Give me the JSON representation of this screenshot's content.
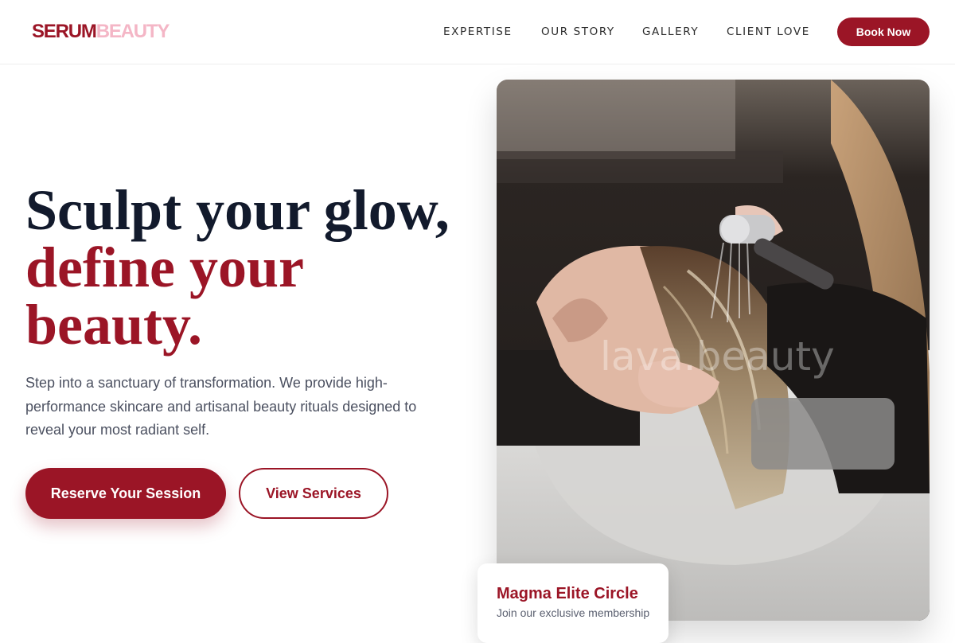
{
  "brand": {
    "part1": "SERUM",
    "part2": "BEAUTY"
  },
  "nav": {
    "items": [
      "EXPERTISE",
      "OUR STORY",
      "GALLERY",
      "CLIENT LOVE"
    ],
    "cta_label": "Book Now"
  },
  "hero": {
    "headline_line1": "Sculpt your glow,",
    "headline_line2": "define your",
    "headline_line3": "beauty.",
    "subtext": "Step into a sanctuary of transformation. We provide high-performance skincare and artisanal beauty rituals designed to reveal your most radiant self.",
    "primary_cta": "Reserve Your Session",
    "secondary_cta": "View Services",
    "image_alt": "Stylist washing a client's hair at a salon basin",
    "watermark": "lava.beauty"
  },
  "membership_card": {
    "title": "Magma Elite Circle",
    "subtitle": "Join our exclusive membership"
  },
  "colors": {
    "accent": "#9b1526",
    "brand_light": "#f4b6c6",
    "headline_dark": "#121a2c"
  }
}
